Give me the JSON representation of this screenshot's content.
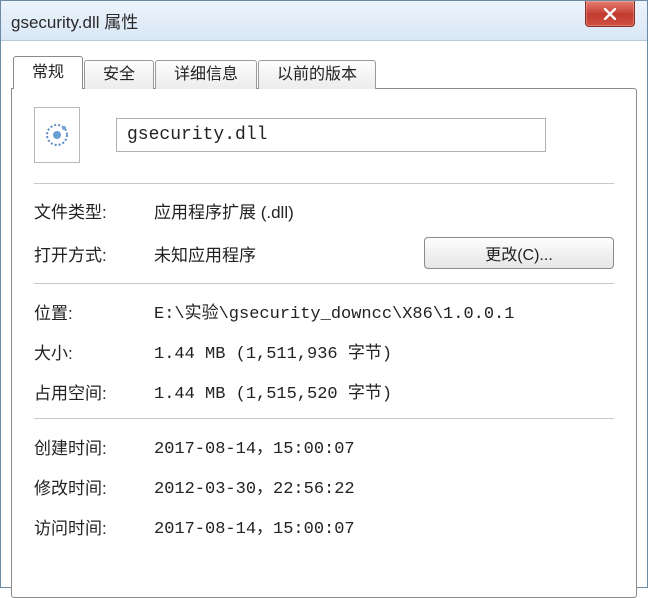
{
  "window": {
    "title": "gsecurity.dll 属性"
  },
  "tabs": {
    "general": "常规",
    "security": "安全",
    "details": "详细信息",
    "previous": "以前的版本"
  },
  "file": {
    "name": "gsecurity.dll"
  },
  "fields": {
    "type_label": "文件类型:",
    "type_value": "应用程序扩展 (.dll)",
    "open_label": "打开方式:",
    "open_value": "未知应用程序",
    "change_button": "更改(C)...",
    "location_label": "位置:",
    "location_value": "E:\\实验\\gsecurity_downcc\\X86\\1.0.0.1",
    "size_label": "大小:",
    "size_value": "1.44 MB (1,511,936 字节)",
    "disk_label": "占用空间:",
    "disk_value": "1.44 MB (1,515,520 字节)",
    "created_label": "创建时间:",
    "created_value": "2017-08-14，15:00:07",
    "modified_label": "修改时间:",
    "modified_value": "2012-03-30，22:56:22",
    "accessed_label": "访问时间:",
    "accessed_value": "2017-08-14，15:00:07"
  }
}
